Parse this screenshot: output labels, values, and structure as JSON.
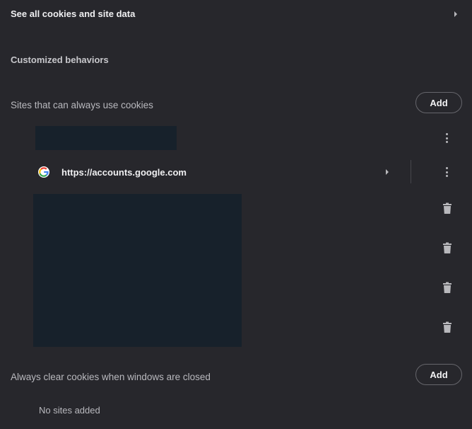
{
  "see_all": {
    "label": "See all cookies and site data",
    "icon": "chevron-right-icon"
  },
  "customized": {
    "title": "Customized behaviors"
  },
  "allow_section": {
    "title": "Sites that can always use cookies",
    "add_label": "Add",
    "sites": [
      {
        "url": "https://accounts.google.com",
        "icon": "google-favicon-icon"
      }
    ]
  },
  "clear_section": {
    "title": "Always clear cookies when windows are closed",
    "add_label": "Add",
    "empty_text": "No sites added"
  },
  "colors": {
    "background": "#27272c",
    "redacted": "#17212b",
    "text": "#f0f0f2",
    "muted_text": "#b9b9be"
  }
}
